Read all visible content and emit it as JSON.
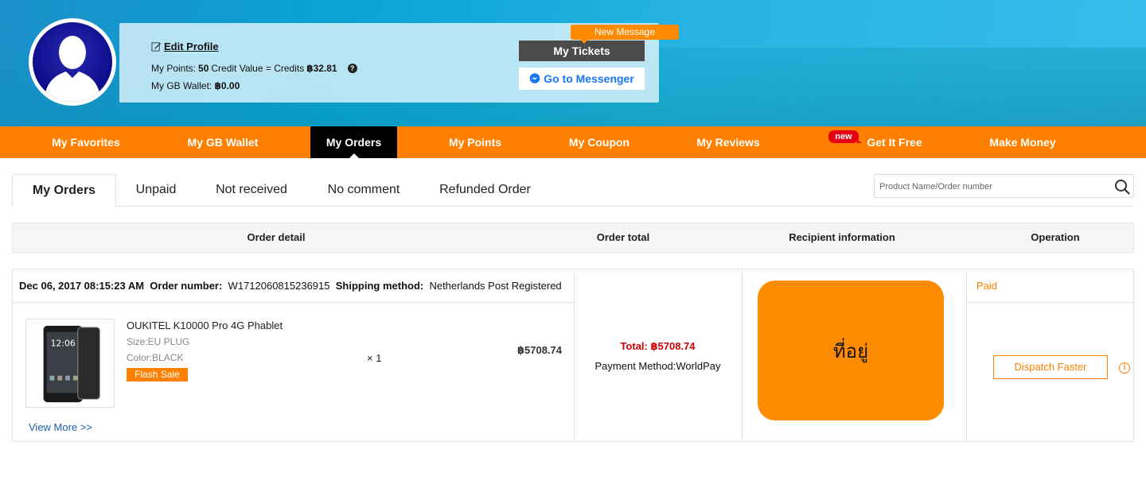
{
  "profile": {
    "edit_label": "Edit Profile",
    "points_prefix": "My Points:",
    "points_value": "50",
    "credit_text": "Credit Value = Credits",
    "credit_value": "฿32.81",
    "help_symbol": "?",
    "wallet_label": "My GB Wallet:",
    "wallet_value": "฿0.00"
  },
  "actions": {
    "new_message": "New Message",
    "tickets": "My Tickets",
    "messenger": "Go to Messenger"
  },
  "nav": {
    "items": [
      "My Favorites",
      "My GB Wallet",
      "My Orders",
      "My Points",
      "My Coupon",
      "My Reviews",
      "Get It Free",
      "Make Money"
    ],
    "active": "My Orders",
    "new_badge": "new"
  },
  "tabs": {
    "items": [
      "My Orders",
      "Unpaid",
      "Not received",
      "No comment",
      "Refunded Order"
    ],
    "active": "My Orders"
  },
  "search": {
    "placeholder": "Product Name/Order number"
  },
  "table": {
    "headers": [
      "Order detail",
      "Order total",
      "Recipient information",
      "Operation"
    ]
  },
  "order": {
    "date": "Dec 06, 2017 08:15:23 AM",
    "number_label": "Order number:",
    "number": "W1712060815236915",
    "shipping_label": "Shipping method:",
    "shipping": "Netherlands Post Registered",
    "product_name": "OUKITEL K10000 Pro 4G Phablet",
    "size": "Size:EU PLUG",
    "color": "Color:BLACK",
    "flash_sale": "Flash Sale",
    "quantity": "× 1",
    "price": "฿5708.74",
    "view_more": "View More >>",
    "total": "Total: ฿5708.74",
    "payment": "Payment Method:WorldPay",
    "address": "ที่อยู่",
    "status": "Paid",
    "dispatch": "Dispatch Faster",
    "phone_time": "12:06"
  },
  "colors": {
    "accent": "#ff8000",
    "active_nav": "#000000",
    "total_red": "#d00000"
  }
}
